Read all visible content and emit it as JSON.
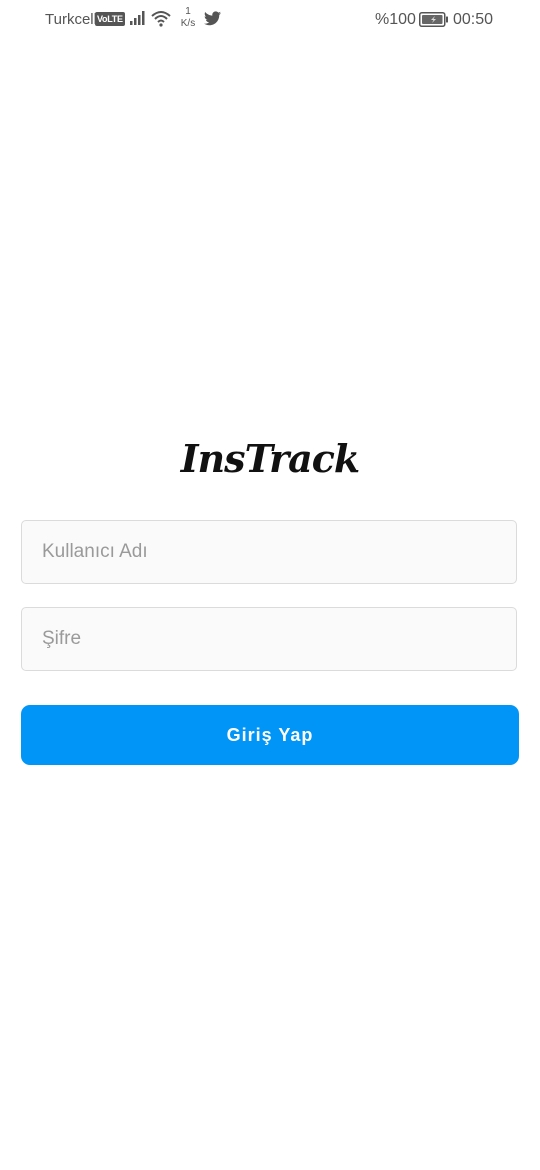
{
  "status_bar": {
    "carrier": "Turkcell",
    "volte": "VoLTE",
    "net_speed_value": "1",
    "net_speed_unit": "K/s",
    "battery": "%100",
    "time": "00:50"
  },
  "app": {
    "logo": "InsTrack"
  },
  "login_form": {
    "username_placeholder": "Kullanıcı Adı",
    "password_placeholder": "Şifre",
    "submit_label": "Giriş Yap"
  },
  "colors": {
    "primary_button": "#0095f6",
    "field_background": "#fafafa",
    "field_border": "#dbdbdb"
  },
  "icons": [
    "signal-icon",
    "wifi-icon",
    "twitter-icon",
    "battery-icon"
  ]
}
